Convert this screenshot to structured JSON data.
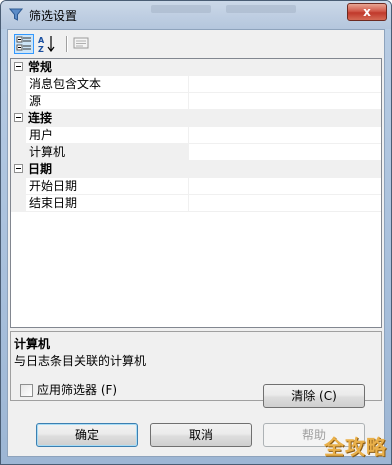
{
  "window": {
    "title": "筛选设置",
    "close_label": "x"
  },
  "toolbar": {
    "icons": [
      "categorized-icon",
      "alphabetical-icon",
      "property-pages-icon"
    ]
  },
  "grid": {
    "categories": [
      {
        "label": "常规",
        "properties": [
          {
            "name": "消息包含文本",
            "value": ""
          },
          {
            "name": "源",
            "value": ""
          }
        ]
      },
      {
        "label": "连接",
        "properties": [
          {
            "name": "用户",
            "value": ""
          },
          {
            "name": "计算机",
            "value": "",
            "selected": true
          }
        ]
      },
      {
        "label": "日期",
        "properties": [
          {
            "name": "开始日期",
            "value": ""
          },
          {
            "name": "结束日期",
            "value": ""
          }
        ]
      }
    ]
  },
  "help": {
    "title": "计算机",
    "description": "与日志条目关联的计算机"
  },
  "apply_filter": {
    "label": "应用筛选器 (F)",
    "checked": false
  },
  "buttons": {
    "clear": "清除 (C)",
    "ok": "确定",
    "cancel": "取消",
    "help": "帮助"
  },
  "watermark": "全攻略"
}
